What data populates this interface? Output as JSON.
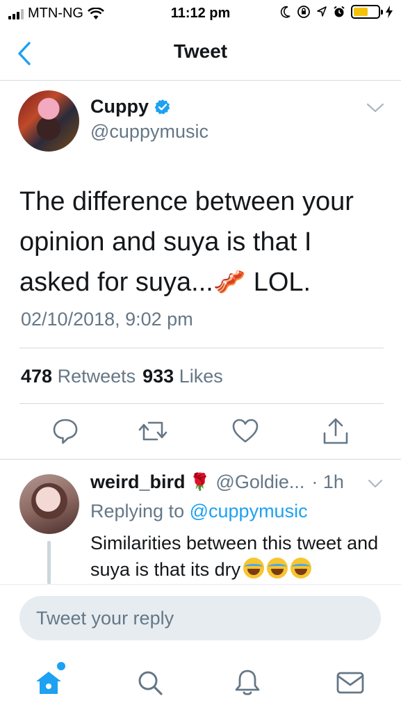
{
  "status_bar": {
    "carrier": "MTN-NG",
    "time": "11:12 pm",
    "battery_color": "#f4c20d"
  },
  "nav": {
    "title": "Tweet",
    "back_icon": "chevron-left-icon"
  },
  "tweet": {
    "author_name": "Cuppy",
    "verified": true,
    "author_handle": "@cuppymusic",
    "text_before_emoji": "The difference between your opinion and suya is that I asked for suya...",
    "emoji": "🥓",
    "text_after_emoji": " LOL.",
    "timestamp": "02/10/2018, 9:02 pm",
    "retweets_count": "478",
    "retweets_label": "Retweets",
    "likes_count": "933",
    "likes_label": "Likes",
    "actions": [
      "reply-icon",
      "retweet-icon",
      "like-icon",
      "share-icon"
    ]
  },
  "reply": {
    "author_name": "weird_bird",
    "name_emoji": "🌹",
    "author_handle": "@Goldie...",
    "time": "· 1h",
    "replying_prefix": "Replying to",
    "replying_to": "@cuppymusic",
    "text": "Similarities between this tweet and suya is that its dry",
    "emojis": "😂😂😂"
  },
  "composer": {
    "placeholder": "Tweet your reply"
  },
  "tabbar": {
    "items": [
      "home-icon",
      "search-icon",
      "notifications-icon",
      "messages-icon"
    ],
    "active": "home-icon"
  },
  "colors": {
    "accent": "#1da1f2",
    "secondary_text": "#657786",
    "primary_text": "#14171a",
    "divider": "#d4d9dd"
  }
}
